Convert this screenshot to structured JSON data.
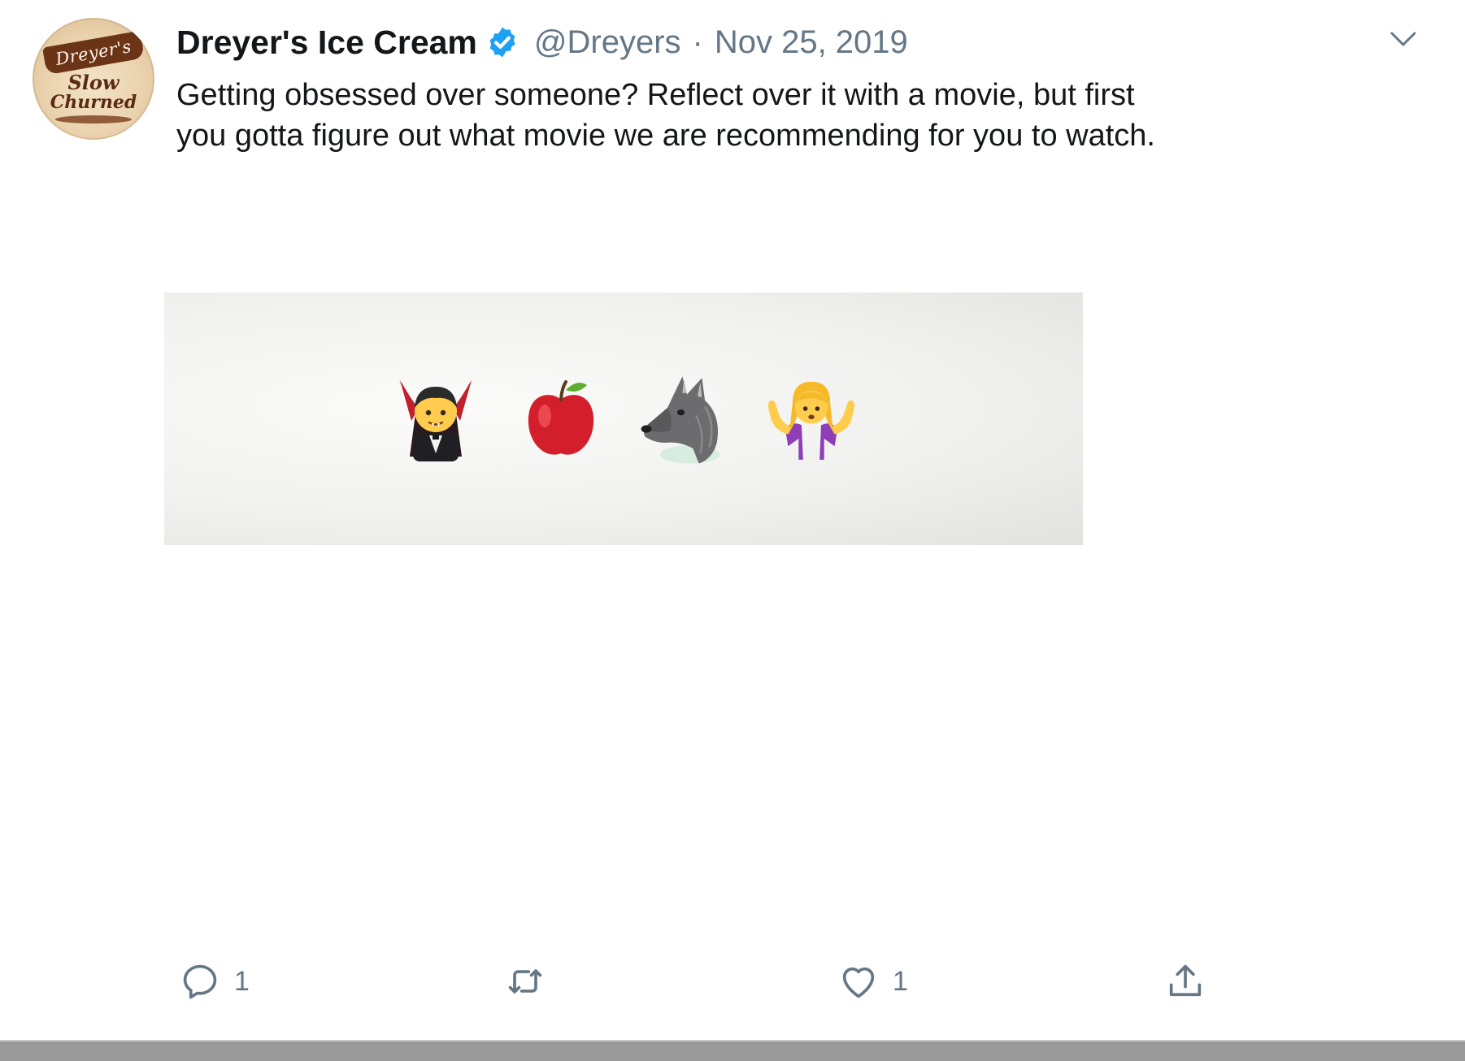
{
  "tweet": {
    "avatar": {
      "icon": "dreyers-logo-icon",
      "logo_text": [
        "Dreyer's",
        "Slow",
        "Churned"
      ]
    },
    "author": {
      "name": "Dreyer's Ice Cream",
      "verified_icon": "verified-badge-icon",
      "handle": "@Dreyers",
      "separator": "·",
      "date": "Nov 25, 2019"
    },
    "menu_icon": "chevron-down-icon",
    "text": "Getting obsessed over someone? Reflect over it with a movie, but first you gotta figure out what movie we are recommending for you to watch.",
    "media": {
      "emojis": [
        "vampire",
        "red-apple",
        "wolf",
        "person-shrugging"
      ]
    },
    "actions": {
      "reply": {
        "icon": "reply-icon",
        "count": "1"
      },
      "retweet": {
        "icon": "retweet-icon",
        "count": ""
      },
      "like": {
        "icon": "heart-icon",
        "count": "1"
      },
      "share": {
        "icon": "share-icon"
      }
    }
  },
  "colors": {
    "text_primary": "#14171a",
    "text_secondary": "#657786",
    "verified_blue": "#1da1f2",
    "brand_brown": "#6b3417"
  }
}
